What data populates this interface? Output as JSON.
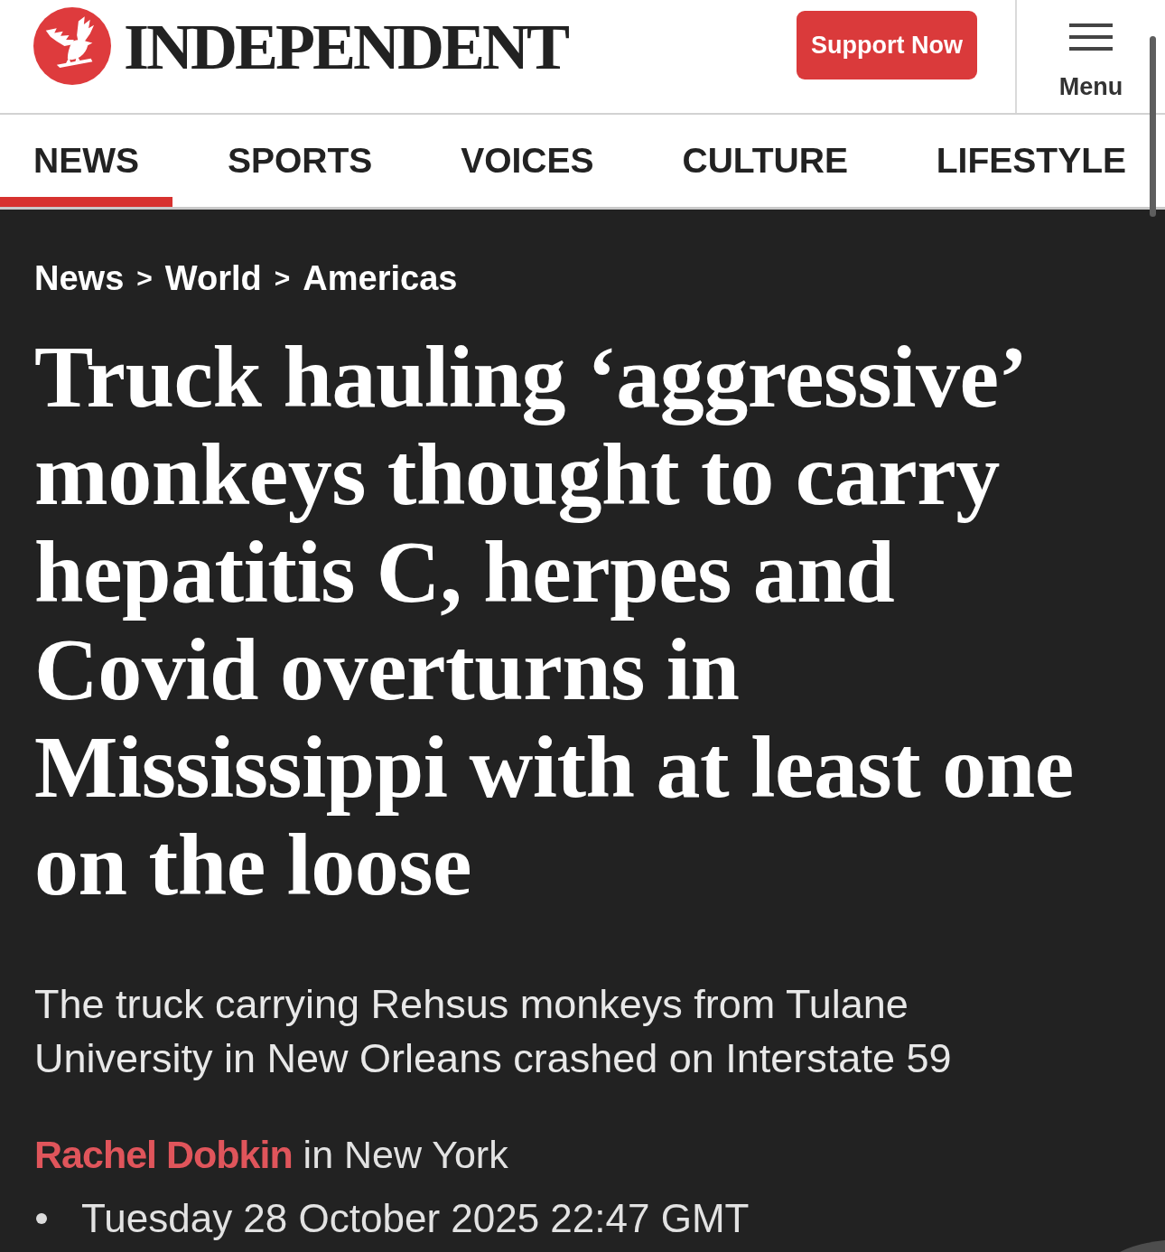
{
  "header": {
    "logo_text": "INDEPENDENT",
    "support_button": "Support Now",
    "menu_label": "Menu"
  },
  "nav": {
    "tabs": [
      {
        "label": "NEWS",
        "selected": true
      },
      {
        "label": "SPORTS",
        "selected": false
      },
      {
        "label": "VOICES",
        "selected": false
      },
      {
        "label": "CULTURE",
        "selected": false
      },
      {
        "label": "LIFESTYLE",
        "selected": false
      }
    ]
  },
  "article": {
    "breadcrumb": [
      {
        "kind": "link",
        "text": "News"
      },
      {
        "kind": "separator",
        "text": ">"
      },
      {
        "kind": "link",
        "text": "World"
      },
      {
        "kind": "separator",
        "text": ">"
      },
      {
        "kind": "link",
        "text": "Americas"
      }
    ],
    "headline": "Truck hauling ‘aggressive’ monkeys thought to carry hepatitis C, herpes and Covid overturns in Mississippi with at least one on the loose",
    "standfirst": "The truck carrying Rehsus monkeys from Tulane University in New Orleans crashed on Interstate 59",
    "byline": {
      "author": "Rachel Dobkin",
      "location_text": "in New York"
    },
    "published": "Tuesday 28 October 2025 22:47 GMT"
  }
}
